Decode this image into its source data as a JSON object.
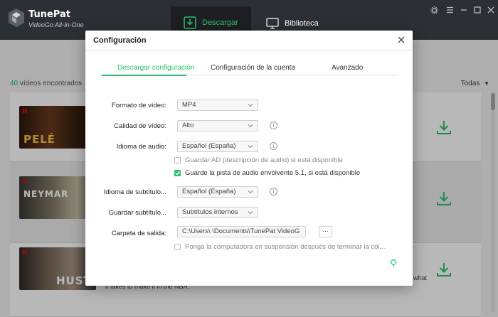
{
  "app": {
    "name": "TunePat",
    "subtitle": "VideoGo All-In-One"
  },
  "nav": {
    "download": "Descargar",
    "library": "Biblioteca"
  },
  "main": {
    "found_count": "40",
    "found_text": "vídeos encontrados",
    "filter": "Todas",
    "videos": [
      {
        "title": "PELÉ",
        "brand": "N"
      },
      {
        "title": "NEYMAR",
        "brand": "N"
      },
      {
        "title": "HUSTLE",
        "brand": "N"
      }
    ],
    "desc_fragment_1": "what",
    "desc_fragment_2": "it takes to make it in the NBA."
  },
  "dialog": {
    "title": "Configuración",
    "tabs": [
      "Descargar configuración",
      "Configuración de la cuenta",
      "Avanzado"
    ],
    "fields": {
      "video_format": {
        "label": "Formato de vídeo:",
        "value": "MP4"
      },
      "video_quality": {
        "label": "Calidad de vídeo:",
        "value": "Alto"
      },
      "audio_language": {
        "label": "Idioma de audio:",
        "value": "Español (España)"
      },
      "subtitle_language": {
        "label": "Idioma de subtítulo...",
        "value": "Español (España)"
      },
      "save_subtitles": {
        "label": "Guardar subtítulo...",
        "value": "Subtítulos internos"
      },
      "output_folder": {
        "label": "Carpeta de salida:",
        "value": "C:\\Users\\      \\Documents\\TunePat VideoG"
      }
    },
    "checks": {
      "save_ad": {
        "label": "Guardar AD (descripción de audio) si está disponible",
        "checked": false
      },
      "save_51": {
        "label": "Guarde la pista de audio envolvente 5.1, si está disponible",
        "checked": true
      },
      "sleep": {
        "label": "Ponga la computadora en suspensión después de terminar la col...",
        "checked": false
      }
    },
    "browse": "···"
  },
  "colors": {
    "accent": "#2ec06f",
    "titlebar": "#2c2f35"
  }
}
